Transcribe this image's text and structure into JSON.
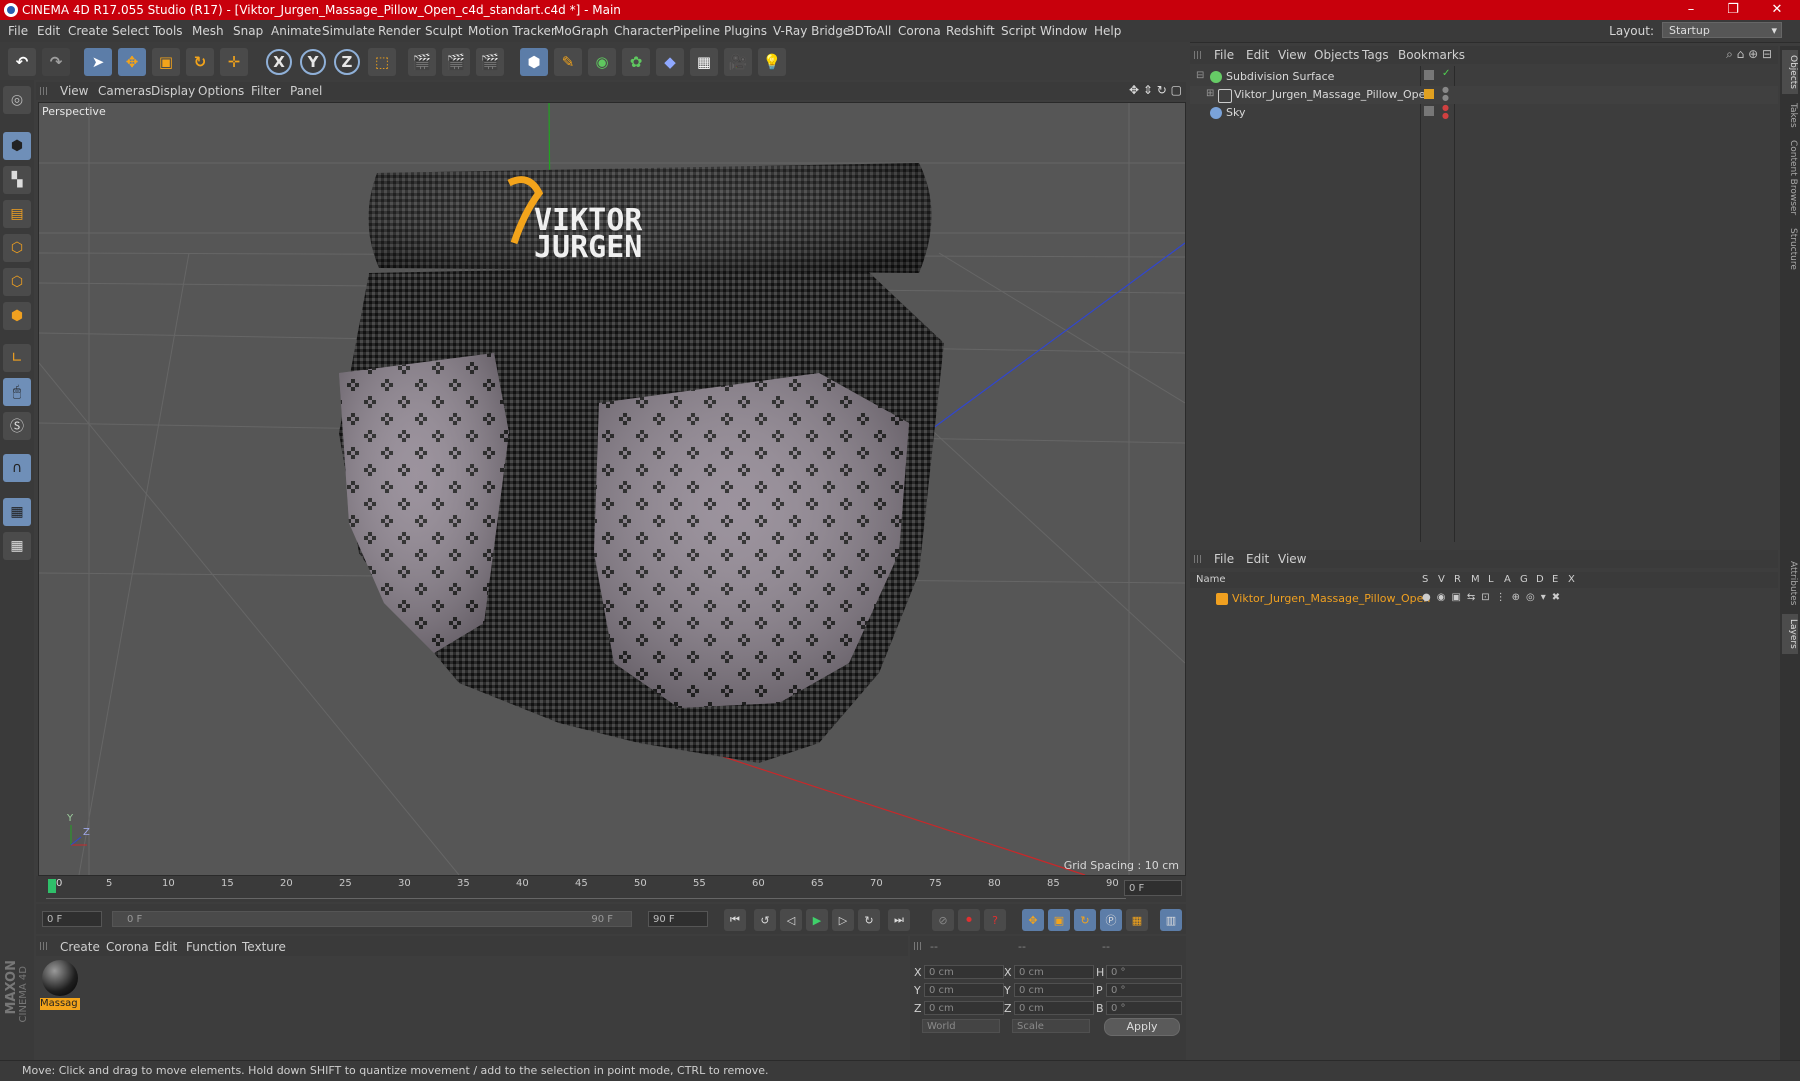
{
  "window": {
    "title": "CINEMA 4D R17.055 Studio (R17) - [Viktor_Jurgen_Massage_Pillow_Open_c4d_standart.c4d *] - Main",
    "controls": [
      "–",
      "❐",
      "✕"
    ]
  },
  "menubar": {
    "items": [
      "File",
      "Edit",
      "Create",
      "Select",
      "Tools",
      "Mesh",
      "Snap",
      "Animate",
      "Simulate",
      "Render",
      "Sculpt",
      "Motion Tracker",
      "MoGraph",
      "Character",
      "Pipeline",
      "Plugins",
      "V-Ray Bridge",
      "3DToAll",
      "Corona",
      "Redshift",
      "Script",
      "Window",
      "Help"
    ],
    "layout_label": "Layout:",
    "layout_value": "Startup"
  },
  "toolbar": {
    "axis_x": "X",
    "axis_y": "Y",
    "axis_z": "Z"
  },
  "viewport": {
    "menu": [
      "View",
      "Cameras",
      "Display",
      "Options",
      "Filter",
      "Panel"
    ],
    "camera_label": "Perspective",
    "grid_spacing": "Grid Spacing : 10 cm",
    "logo_line1": "VIKTOR",
    "logo_line2": "JURGEN",
    "axis_y": "Y",
    "axis_z": "Z"
  },
  "timeline": {
    "ticks": [
      "0",
      "5",
      "10",
      "15",
      "20",
      "25",
      "30",
      "35",
      "40",
      "45",
      "50",
      "55",
      "60",
      "65",
      "70",
      "75",
      "80",
      "85",
      "90"
    ],
    "end_field": "0 F",
    "start_field": "0 F",
    "range_start": "0 F",
    "range_end": "90 F",
    "end_frame": "90 F"
  },
  "materials": {
    "menu": [
      "Create",
      "Corona",
      "Edit",
      "Function",
      "Texture"
    ],
    "items": [
      {
        "label": "Massag"
      }
    ],
    "maxon_line1": "MAXON",
    "maxon_line2": "CINEMA 4D"
  },
  "coordinates": {
    "headers": [
      "--",
      "--",
      "--"
    ],
    "rows": [
      {
        "a": "X",
        "av": "0 cm",
        "b": "X",
        "bv": "0 cm",
        "c": "H",
        "cv": "0 °"
      },
      {
        "a": "Y",
        "av": "0 cm",
        "b": "Y",
        "bv": "0 cm",
        "c": "P",
        "cv": "0 °"
      },
      {
        "a": "Z",
        "av": "0 cm",
        "b": "Z",
        "bv": "0 cm",
        "c": "B",
        "cv": "0 °"
      }
    ],
    "mode": "World",
    "scale": "Scale",
    "apply": "Apply"
  },
  "object_manager": {
    "menu": [
      "File",
      "Edit",
      "View",
      "Objects",
      "Tags",
      "Bookmarks"
    ],
    "objects": [
      {
        "name": "Subdivision Surface",
        "color": "#66cc66"
      },
      {
        "name": "Viktor_Jurgen_Massage_Pillow_Open",
        "color": "#e0a020"
      },
      {
        "name": "Sky",
        "color": "#7aa2d8"
      }
    ]
  },
  "layer_manager": {
    "menu": [
      "File",
      "Edit",
      "View"
    ],
    "columns": [
      "Name",
      "S",
      "V",
      "R",
      "M",
      "L",
      "A",
      "G",
      "D",
      "E",
      "X"
    ],
    "layers": [
      {
        "name": "Viktor_Jurgen_Massage_Pillow_Open",
        "color": "#f0a020"
      }
    ]
  },
  "side_tabs": [
    "Objects",
    "Takes",
    "Content Browser",
    "Structure",
    "Attributes",
    "Layers"
  ],
  "status": {
    "text": "Move: Click and drag to move elements. Hold down SHIFT to quantize movement / add to the selection in point mode, CTRL to remove."
  },
  "colors": {
    "titlebar": "#c8000c",
    "accent_orange": "#f3a41b",
    "selection_blue": "#5c7da8"
  }
}
